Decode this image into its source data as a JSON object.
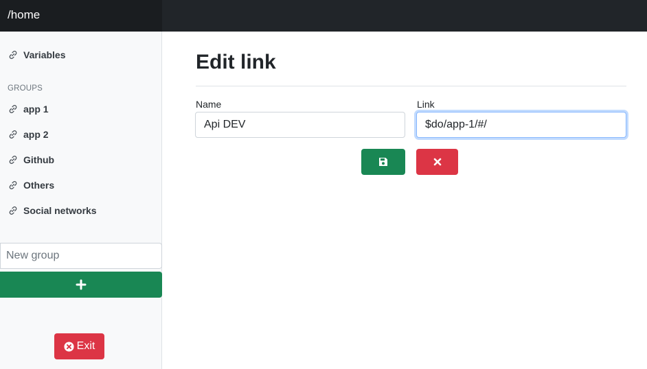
{
  "topbar": {
    "path": "/home"
  },
  "sidebar": {
    "variables_label": "Variables",
    "groups_heading": "GROUPS",
    "groups": [
      {
        "label": "app 1"
      },
      {
        "label": "app 2"
      },
      {
        "label": "Github"
      },
      {
        "label": "Others"
      },
      {
        "label": "Social networks"
      }
    ],
    "new_group_placeholder": "New group",
    "exit_label": "Exit"
  },
  "main": {
    "title": "Edit link",
    "name_label": "Name",
    "name_value": "Api DEV",
    "link_label": "Link",
    "link_value": "$do/app-1/#/"
  },
  "colors": {
    "success": "#198754",
    "danger": "#dc3545",
    "dark": "#212529"
  },
  "icons": {
    "link": "link-icon",
    "save": "floppy-disk-icon",
    "cancel": "close-icon",
    "add": "plus-icon",
    "exit": "circle-x-icon"
  }
}
